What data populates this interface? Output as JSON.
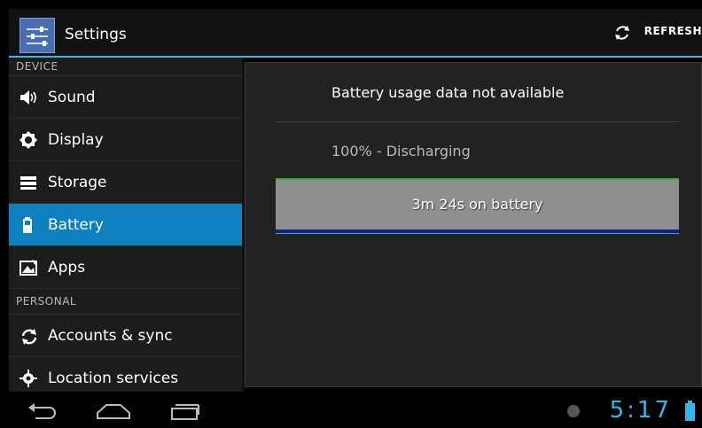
{
  "header": {
    "title": "Settings",
    "refresh_label": "REFRESH"
  },
  "sidebar": {
    "section_device": "DEVICE",
    "items": [
      {
        "label": "Sound",
        "icon": "speaker-icon"
      },
      {
        "label": "Display",
        "icon": "brightness-icon"
      },
      {
        "label": "Storage",
        "icon": "storage-icon"
      },
      {
        "label": "Battery",
        "icon": "battery-icon",
        "active": true
      },
      {
        "label": "Apps",
        "icon": "apps-icon"
      }
    ],
    "section_personal": "PERSONAL",
    "items2": [
      {
        "label": "Accounts & sync",
        "icon": "sync-icon"
      },
      {
        "label": "Location services",
        "icon": "location-icon"
      }
    ]
  },
  "detail": {
    "message": "Battery usage data not available",
    "status": "100% - Discharging",
    "bar_text": "3m 24s on battery"
  },
  "status_bar": {
    "time": "5:17"
  },
  "colors": {
    "accent": "#33b5e5",
    "active_item": "#0e7fbf"
  }
}
